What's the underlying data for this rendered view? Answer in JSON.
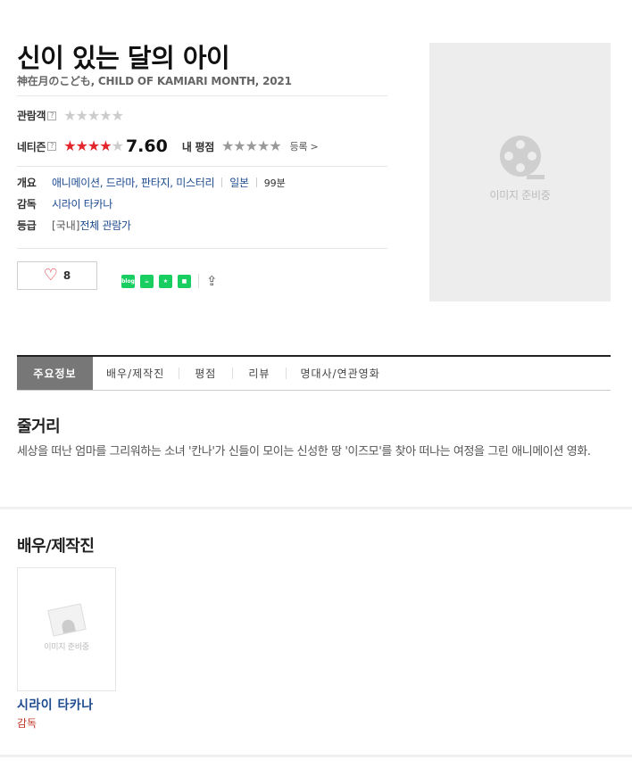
{
  "movie": {
    "title": "신이 있는 달의 아이",
    "subtitle": "神在月のこども, CHILD OF KAMIARI MONTH, 2021"
  },
  "ratings": {
    "audience_label": "관람객",
    "audience_help": "?",
    "audience_stars": 0,
    "netizen_label": "네티즌",
    "netizen_help": "?",
    "netizen_stars": 4,
    "netizen_score": "7.60",
    "my_rating_label": "내 평점",
    "register_label": "등록 >"
  },
  "info": {
    "overview_label": "개요",
    "genres": "애니메이션, 드라마, 판타지, 미스터리",
    "country": "일본",
    "runtime": "99분",
    "director_label": "감독",
    "director": "시라이 타카나",
    "grade_label": "등급",
    "grade_region": "[국내]",
    "grade": "전체 관람가"
  },
  "actions": {
    "like_count": "8",
    "share_buttons": [
      {
        "name": "blog-share-icon",
        "color": "#19ce60",
        "glyph": "blog"
      },
      {
        "name": "cafe-share-icon",
        "color": "#19ce60",
        "glyph": "☕"
      },
      {
        "name": "bookmark-share-icon",
        "color": "#19ce60",
        "glyph": "★"
      },
      {
        "name": "memo-share-icon",
        "color": "#19ce60",
        "glyph": "■"
      }
    ]
  },
  "poster": {
    "placeholder_text": "이미지 준비중"
  },
  "tabs": [
    {
      "label": "주요정보",
      "active": true
    },
    {
      "label": "배우/제작진",
      "active": false
    },
    {
      "label": "평점",
      "active": false
    },
    {
      "label": "리뷰",
      "active": false
    },
    {
      "label": "명대사/연관영화",
      "active": false
    }
  ],
  "synopsis": {
    "title": "줄거리",
    "text": "세상을 떠난 엄마를 그리워하는 소녀 '칸나'가 신들이 모이는 신성한 땅 '이즈모'를 찾아 떠나는 여정을 그린 애니메이션 영화."
  },
  "cast": {
    "title": "배우/제작진",
    "members": [
      {
        "name": "시라이 타카나",
        "role": "감독",
        "placeholder_text": "이미지 준비중"
      }
    ]
  }
}
